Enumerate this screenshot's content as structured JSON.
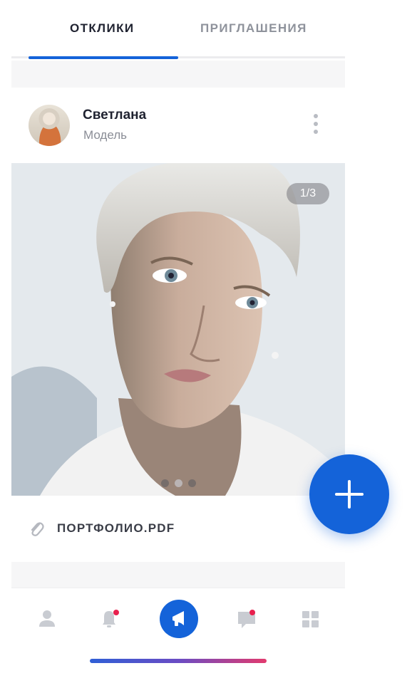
{
  "tabs": {
    "responses": "ОТКЛИКИ",
    "invitations": "ПРИГЛАШЕНИЯ",
    "active_color": "#1463d9"
  },
  "card": {
    "name": "Светлана",
    "role": "Модель",
    "photo_counter": "1/3",
    "carousel": {
      "total": 3,
      "current": 1
    },
    "attachment": "ПОРТФОЛИО.PDF"
  },
  "fab": {
    "icon": "plus-icon",
    "color": "#1463d9"
  },
  "bottom_nav": {
    "items": [
      {
        "icon": "profile-icon",
        "badge": false
      },
      {
        "icon": "bell-icon",
        "badge": true
      },
      {
        "icon": "megaphone-icon",
        "active": true
      },
      {
        "icon": "chat-icon",
        "badge": true
      },
      {
        "icon": "grid-icon",
        "badge": false
      }
    ],
    "badge_color": "#e8204e"
  }
}
